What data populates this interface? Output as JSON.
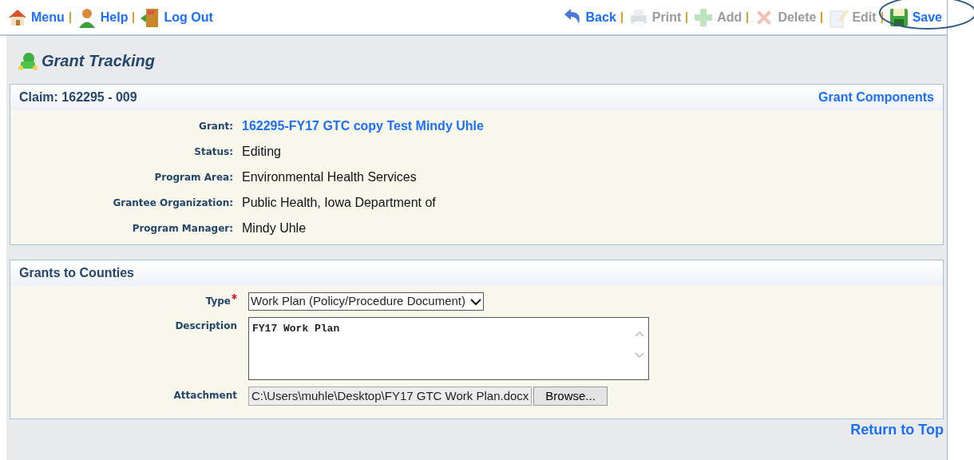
{
  "toolbar_left": [
    {
      "kind": "home",
      "label": "Menu",
      "disabled": false
    },
    {
      "kind": "help",
      "label": "Help",
      "disabled": false
    },
    {
      "kind": "logout",
      "label": "Log Out",
      "disabled": false
    }
  ],
  "toolbar_right": [
    {
      "kind": "back",
      "label": "Back",
      "disabled": false
    },
    {
      "kind": "print",
      "label": "Print",
      "disabled": true
    },
    {
      "kind": "add",
      "label": "Add",
      "disabled": true
    },
    {
      "kind": "delete",
      "label": "Delete",
      "disabled": true
    },
    {
      "kind": "edit",
      "label": "Edit",
      "disabled": true
    },
    {
      "kind": "save",
      "label": "Save",
      "disabled": false,
      "circled": true
    }
  ],
  "page_title": "Grant Tracking",
  "claim_panel": {
    "title": "Claim: 162295 - 009",
    "link": "Grant Components",
    "fields": [
      {
        "kind": "link",
        "label": "Grant:",
        "value": "162295-FY17 GTC copy Test Mindy Uhle"
      },
      {
        "kind": "text",
        "label": "Status:",
        "value": "Editing"
      },
      {
        "kind": "text",
        "label": "Program Area:",
        "value": "Environmental Health Services"
      },
      {
        "kind": "text",
        "label": "Grantee Organization:",
        "value": "Public Health, Iowa Department of"
      },
      {
        "kind": "text",
        "label": "Program Manager:",
        "value": "Mindy Uhle"
      }
    ]
  },
  "counties_panel": {
    "title": "Grants to Counties",
    "fields": [
      {
        "kind": "select",
        "label": "Type",
        "required": true,
        "value": "Work Plan (Policy/Procedure Document)"
      },
      {
        "kind": "textarea",
        "label": "Description",
        "required": false,
        "value": "FY17 Work Plan"
      },
      {
        "kind": "file",
        "label": "Attachment",
        "required": false,
        "value": "C:\\Users\\muhle\\Desktop\\FY17 GTC Work Plan.docx",
        "button": "Browse..."
      }
    ]
  },
  "return_link": "Return to Top"
}
